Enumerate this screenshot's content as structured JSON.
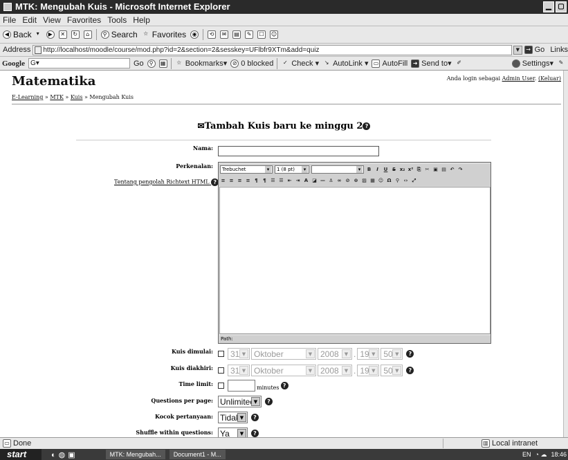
{
  "window": {
    "title": "MTK: Mengubah Kuis - Microsoft Internet Explorer",
    "controls": [
      "▁",
      "▢"
    ]
  },
  "menu": [
    "File",
    "Edit",
    "View",
    "Favorites",
    "Tools",
    "Help"
  ],
  "toolbar": {
    "back": "Back",
    "search": "Search",
    "favorites": "Favorites"
  },
  "address": {
    "label": "Address",
    "url": "http://localhost/moodle/course/mod.php?id=2&section=2&sesskey=UFlbfr9XTm&add=quiz",
    "go": "Go",
    "links": "Links"
  },
  "googlebar": {
    "logo": "Google",
    "input": "G▾",
    "go": "Go",
    "bookmarks": "Bookmarks▾",
    "blocked": "0 blocked",
    "check": "Check ▾",
    "autolink": "AutoLink ▾",
    "autofill": "AutoFill",
    "sendto": "Send to▾",
    "settings": "Settings▾"
  },
  "page": {
    "site_title": "Matematika",
    "login_prefix": "Anda login sebagai ",
    "login_user": "Admin User",
    "login_logout": "(Keluar)",
    "breadcrumb": [
      "E-Learning",
      "MTK",
      "Kuis",
      "Mengubah Kuis"
    ],
    "breadcrumb_sep": " » ",
    "heading": "Tambah Kuis baru ke minggu 2",
    "labels": {
      "nama": "Nama:",
      "perkenalan": "Perkenalan:",
      "kuis_dimulai": "Kuis dimulai:",
      "kuis_diakhiri": "Kuis diakhiri:",
      "time_limit": "Time limit:",
      "questions_per_page": "Questions per page:",
      "kocok": "Kocok pertanyaan:",
      "shuffle": "Shuffle within questions:"
    },
    "richtext_help": "Tentang pengolah Richtext HTML",
    "editor": {
      "font": "Trebuchet",
      "size": "1 (8 pt)",
      "path": "Path:"
    },
    "date_start": {
      "day": "31",
      "month": "Oktober",
      "year": "2008",
      "hour": "19",
      "min": "50"
    },
    "date_end": {
      "day": "31",
      "month": "Oktober",
      "year": "2008",
      "hour": "19",
      "min": "50"
    },
    "minutes": "minutes",
    "questions_per_page": "Unlimited",
    "kocok": "Tidak",
    "shuffle": "Ya"
  },
  "status": {
    "text": "Done",
    "zone": "Local intranet"
  },
  "taskbar": {
    "start": "start",
    "tasks": [
      "MTK: Mengubah...",
      "Document1 - M..."
    ],
    "time": "18:46",
    "tray": "EN"
  }
}
